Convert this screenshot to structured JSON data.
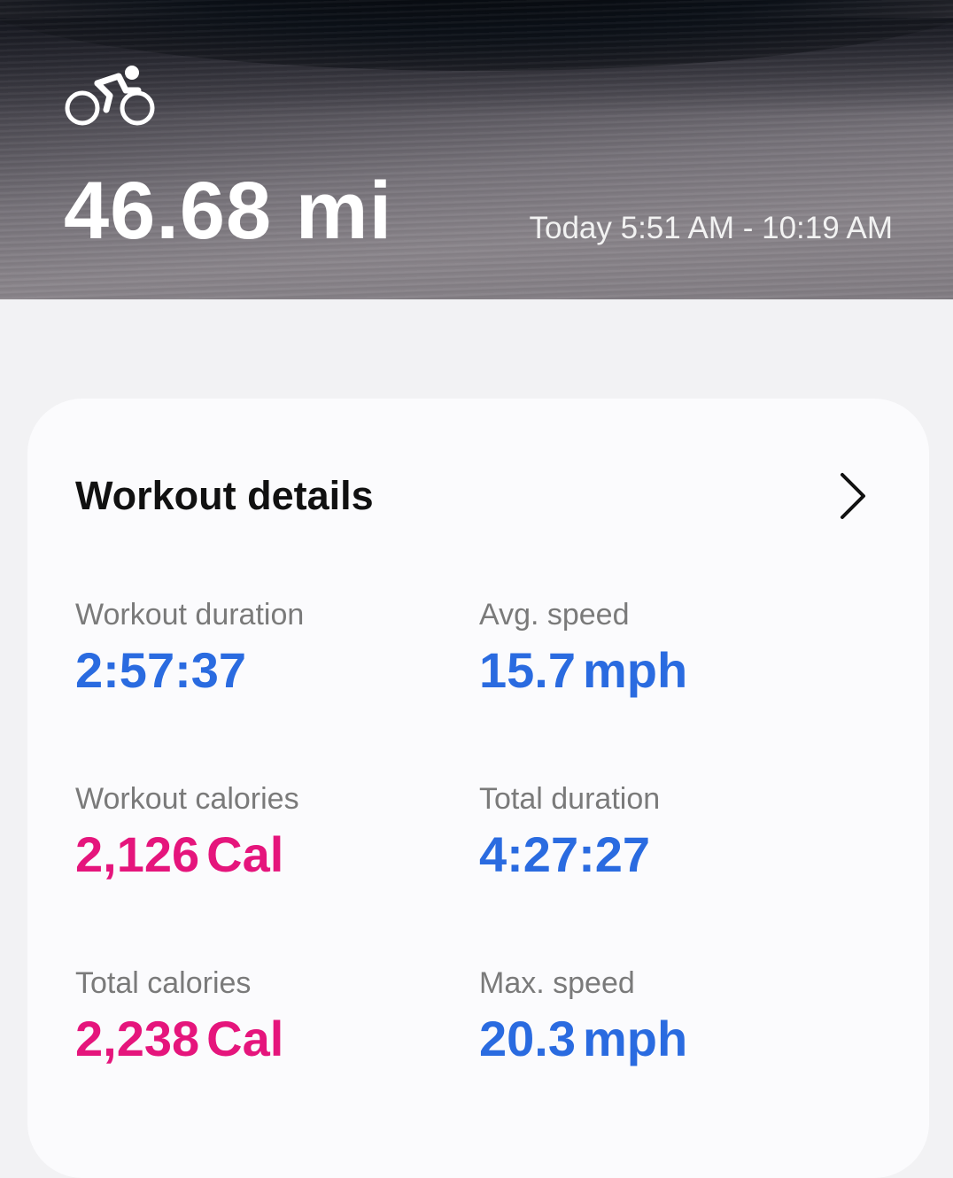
{
  "header": {
    "activity_icon": "cycling-icon",
    "distance": "46.68 mi",
    "time_range": "Today 5:51 AM - 10:19 AM"
  },
  "workout_details": {
    "title": "Workout details",
    "chevron_icon": "chevron-right-icon",
    "stats": {
      "workout_duration": {
        "label": "Workout duration",
        "value": "2:57:37",
        "unit": ""
      },
      "avg_speed": {
        "label": "Avg. speed",
        "value": "15.7",
        "unit": "mph"
      },
      "workout_calories": {
        "label": "Workout calories",
        "value": "2,126",
        "unit": "Cal"
      },
      "total_duration": {
        "label": "Total duration",
        "value": "4:27:27",
        "unit": ""
      },
      "total_calories": {
        "label": "Total calories",
        "value": "2,238",
        "unit": "Cal"
      },
      "max_speed": {
        "label": "Max. speed",
        "value": "20.3",
        "unit": "mph"
      }
    }
  },
  "colors": {
    "blue_value": "#2a6be0",
    "pink_value": "#e5157c",
    "card_bg": "#fbfbfd",
    "page_bg": "#f2f2f4"
  }
}
